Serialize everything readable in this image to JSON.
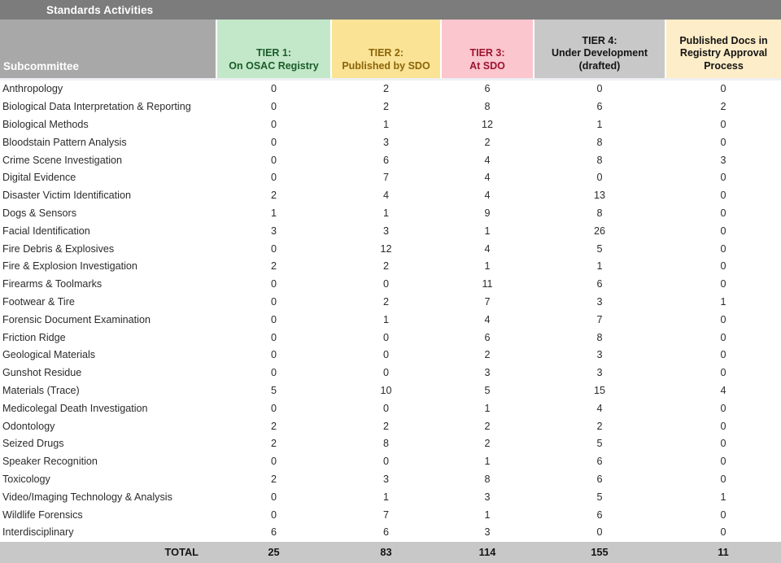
{
  "title_bar": {
    "text": "Standards Activities"
  },
  "theme": {
    "title_bar_bg": "#7c7c7c",
    "header_bg": "#a8a8a8",
    "tier1_bg": "#c3e8c9",
    "tier1_fg": "#1a5c28",
    "tier2_bg": "#fbe396",
    "tier2_fg": "#8a6508",
    "tier3_bg": "#fbc6ce",
    "tier3_fg": "#9c142f",
    "tier4_bg": "#c8c8c8",
    "tier4_fg": "#141414",
    "pubdocs_bg": "#fdedc8",
    "pubdocs_fg": "#141414",
    "total_bg": "#c8c8c8",
    "row_bg": "#ffffff",
    "text": "#2b2b2b"
  },
  "columns": [
    {
      "key": "subcommittee",
      "label": "Subcommittee"
    },
    {
      "key": "tier1",
      "label_line1": "TIER 1:",
      "label_line2": "On OSAC Registry"
    },
    {
      "key": "tier2",
      "label_line1": "TIER 2:",
      "label_line2": "Published by SDO"
    },
    {
      "key": "tier3",
      "label_line1": "TIER 3:",
      "label_line2": "At SDO"
    },
    {
      "key": "tier4",
      "label_line1": "TIER 4:",
      "label_line2": "Under Development",
      "label_line3": "(drafted)"
    },
    {
      "key": "pubdocs",
      "label_line1": "Published Docs in",
      "label_line2": "Registry Approval",
      "label_line3": "Process"
    }
  ],
  "rows": [
    {
      "name": "Anthropology",
      "tier1": "0",
      "tier2": "2",
      "tier3": "6",
      "tier4": "0",
      "pubdocs": "0"
    },
    {
      "name": "Biological Data Interpretation & Reporting",
      "tier1": "0",
      "tier2": "2",
      "tier3": "8",
      "tier4": "6",
      "pubdocs": "2"
    },
    {
      "name": "Biological Methods",
      "tier1": "0",
      "tier2": "1",
      "tier3": "12",
      "tier4": "1",
      "pubdocs": "0"
    },
    {
      "name": "Bloodstain Pattern Analysis",
      "tier1": "0",
      "tier2": "3",
      "tier3": "2",
      "tier4": "8",
      "pubdocs": "0"
    },
    {
      "name": "Crime Scene Investigation",
      "tier1": "0",
      "tier2": "6",
      "tier3": "4",
      "tier4": "8",
      "pubdocs": "3"
    },
    {
      "name": "Digital Evidence",
      "tier1": "0",
      "tier2": "7",
      "tier3": "4",
      "tier4": "0",
      "pubdocs": "0"
    },
    {
      "name": "Disaster Victim Identification",
      "tier1": "2",
      "tier2": "4",
      "tier3": "4",
      "tier4": "13",
      "pubdocs": "0"
    },
    {
      "name": "Dogs & Sensors",
      "tier1": "1",
      "tier2": "1",
      "tier3": "9",
      "tier4": "8",
      "pubdocs": "0"
    },
    {
      "name": "Facial Identification",
      "tier1": "3",
      "tier2": "3",
      "tier3": "1",
      "tier4": "26",
      "pubdocs": "0"
    },
    {
      "name": "Fire Debris & Explosives",
      "tier1": "0",
      "tier2": "12",
      "tier3": "4",
      "tier4": "5",
      "pubdocs": "0"
    },
    {
      "name": "Fire & Explosion Investigation",
      "tier1": "2",
      "tier2": "2",
      "tier3": "1",
      "tier4": "1",
      "pubdocs": "0"
    },
    {
      "name": "Firearms & Toolmarks",
      "tier1": "0",
      "tier2": "0",
      "tier3": "11",
      "tier4": "6",
      "pubdocs": "0"
    },
    {
      "name": "Footwear & Tire",
      "tier1": "0",
      "tier2": "2",
      "tier3": "7",
      "tier4": "3",
      "pubdocs": "1"
    },
    {
      "name": "Forensic Document Examination",
      "tier1": "0",
      "tier2": "1",
      "tier3": "4",
      "tier4": "7",
      "pubdocs": "0"
    },
    {
      "name": "Friction Ridge",
      "tier1": "0",
      "tier2": "0",
      "tier3": "6",
      "tier4": "8",
      "pubdocs": "0"
    },
    {
      "name": "Geological Materials",
      "tier1": "0",
      "tier2": "0",
      "tier3": "2",
      "tier4": "3",
      "pubdocs": "0"
    },
    {
      "name": "Gunshot Residue",
      "tier1": "0",
      "tier2": "0",
      "tier3": "3",
      "tier4": "3",
      "pubdocs": "0"
    },
    {
      "name": "Materials (Trace)",
      "tier1": "5",
      "tier2": "10",
      "tier3": "5",
      "tier4": "15",
      "pubdocs": "4"
    },
    {
      "name": "Medicolegal Death Investigation",
      "tier1": "0",
      "tier2": "0",
      "tier3": "1",
      "tier4": "4",
      "pubdocs": "0"
    },
    {
      "name": "Odontology",
      "tier1": "2",
      "tier2": "2",
      "tier3": "2",
      "tier4": "2",
      "pubdocs": "0"
    },
    {
      "name": "Seized Drugs",
      "tier1": "2",
      "tier2": "8",
      "tier3": "2",
      "tier4": "5",
      "pubdocs": "0"
    },
    {
      "name": "Speaker Recognition",
      "tier1": "0",
      "tier2": "0",
      "tier3": "1",
      "tier4": "6",
      "pubdocs": "0"
    },
    {
      "name": "Toxicology",
      "tier1": "2",
      "tier2": "3",
      "tier3": "8",
      "tier4": "6",
      "pubdocs": "0"
    },
    {
      "name": "Video/Imaging Technology & Analysis",
      "tier1": "0",
      "tier2": "1",
      "tier3": "3",
      "tier4": "5",
      "pubdocs": "1"
    },
    {
      "name": "Wildlife Forensics",
      "tier1": "0",
      "tier2": "7",
      "tier3": "1",
      "tier4": "6",
      "pubdocs": "0"
    },
    {
      "name": "Interdisciplinary",
      "tier1": "6",
      "tier2": "6",
      "tier3": "3",
      "tier4": "0",
      "pubdocs": "0"
    }
  ],
  "total": {
    "label": "TOTAL",
    "tier1": "25",
    "tier2": "83",
    "tier3": "114",
    "tier4": "155",
    "pubdocs": "11"
  },
  "chart_data": {
    "type": "table",
    "title": "Standards Activities",
    "categories": [
      "Anthropology",
      "Biological Data Interpretation & Reporting",
      "Biological Methods",
      "Bloodstain Pattern Analysis",
      "Crime Scene Investigation",
      "Digital Evidence",
      "Disaster Victim Identification",
      "Dogs & Sensors",
      "Facial Identification",
      "Fire Debris & Explosives",
      "Fire & Explosion Investigation",
      "Firearms & Toolmarks",
      "Footwear & Tire",
      "Forensic Document Examination",
      "Friction Ridge",
      "Geological Materials",
      "Gunshot Residue",
      "Materials (Trace)",
      "Medicolegal Death Investigation",
      "Odontology",
      "Seized Drugs",
      "Speaker Recognition",
      "Toxicology",
      "Video/Imaging Technology & Analysis",
      "Wildlife Forensics",
      "Interdisciplinary"
    ],
    "series": [
      {
        "name": "TIER 1: On OSAC Registry",
        "values": [
          0,
          0,
          0,
          0,
          0,
          0,
          2,
          1,
          3,
          0,
          2,
          0,
          0,
          0,
          0,
          0,
          0,
          5,
          0,
          2,
          2,
          0,
          2,
          0,
          0,
          6
        ],
        "total": 25
      },
      {
        "name": "TIER 2: Published by SDO",
        "values": [
          2,
          2,
          1,
          3,
          6,
          7,
          4,
          1,
          3,
          12,
          2,
          0,
          2,
          1,
          0,
          0,
          0,
          10,
          0,
          2,
          8,
          0,
          3,
          1,
          7,
          6
        ],
        "total": 83
      },
      {
        "name": "TIER 3: At SDO",
        "values": [
          6,
          8,
          12,
          2,
          4,
          4,
          4,
          9,
          1,
          4,
          1,
          11,
          7,
          4,
          6,
          2,
          3,
          5,
          1,
          2,
          2,
          1,
          8,
          3,
          1,
          3
        ],
        "total": 114
      },
      {
        "name": "TIER 4: Under Development (drafted)",
        "values": [
          0,
          6,
          1,
          8,
          8,
          0,
          13,
          8,
          26,
          5,
          1,
          6,
          3,
          7,
          8,
          3,
          3,
          15,
          4,
          2,
          5,
          6,
          6,
          5,
          6,
          0
        ],
        "total": 155
      },
      {
        "name": "Published Docs in Registry Approval Process",
        "values": [
          0,
          2,
          0,
          0,
          3,
          0,
          0,
          0,
          0,
          0,
          0,
          0,
          1,
          0,
          0,
          0,
          0,
          4,
          0,
          0,
          0,
          0,
          0,
          1,
          0,
          0
        ],
        "total": 11
      }
    ],
    "xlabel": "Subcommittee",
    "ylabel": "",
    "legend": "column-headers"
  }
}
